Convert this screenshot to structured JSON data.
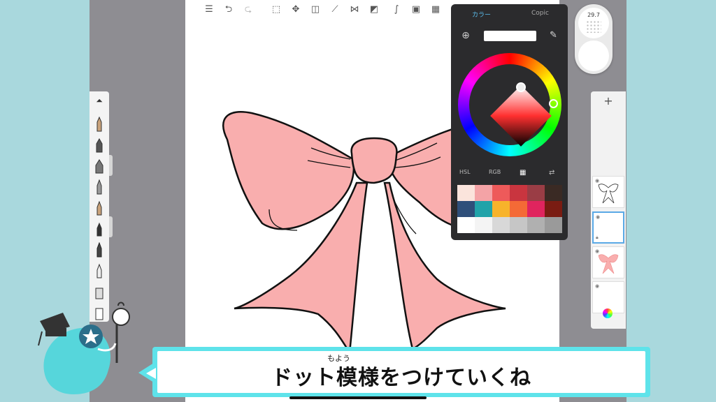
{
  "toolbar": {
    "icons": [
      "layers-list-icon",
      "undo-icon",
      "redo-icon",
      "select-icon",
      "transform-icon",
      "fill-icon",
      "ruler-icon",
      "symmetry-icon",
      "shapes-icon",
      "stroke-icon",
      "image-import-icon",
      "perspective-icon"
    ]
  },
  "brush_puck": {
    "size": "29.7"
  },
  "color_panel": {
    "tab_color": "カラー",
    "tab_copic": "Copic",
    "mode_hsl": "HSL",
    "mode_rgb": "RGB",
    "selected_color": "#e53935",
    "swatches": [
      "#fbe4dc",
      "#f4a3a6",
      "#ee5a5a",
      "#c9353f",
      "#9a3d45",
      "#3a2a24",
      "#2f4f7a",
      "#21a3a9",
      "#f7b32b",
      "#f46a36",
      "#e0245e",
      "#7a1c12",
      "#ffffff",
      "#f4f4f4",
      "#d8d8d8",
      "#c6c6c6",
      "#b0b0b0",
      "#9a9a9a"
    ]
  },
  "layers_panel": {
    "add_label": "+"
  },
  "caption": {
    "text": "ドット模様をつけていくね",
    "furigana": "もよう"
  },
  "colors": {
    "bow_fill": "#f9aeae",
    "caption_border": "#5ee3ea",
    "background": "#a9d8dd"
  }
}
